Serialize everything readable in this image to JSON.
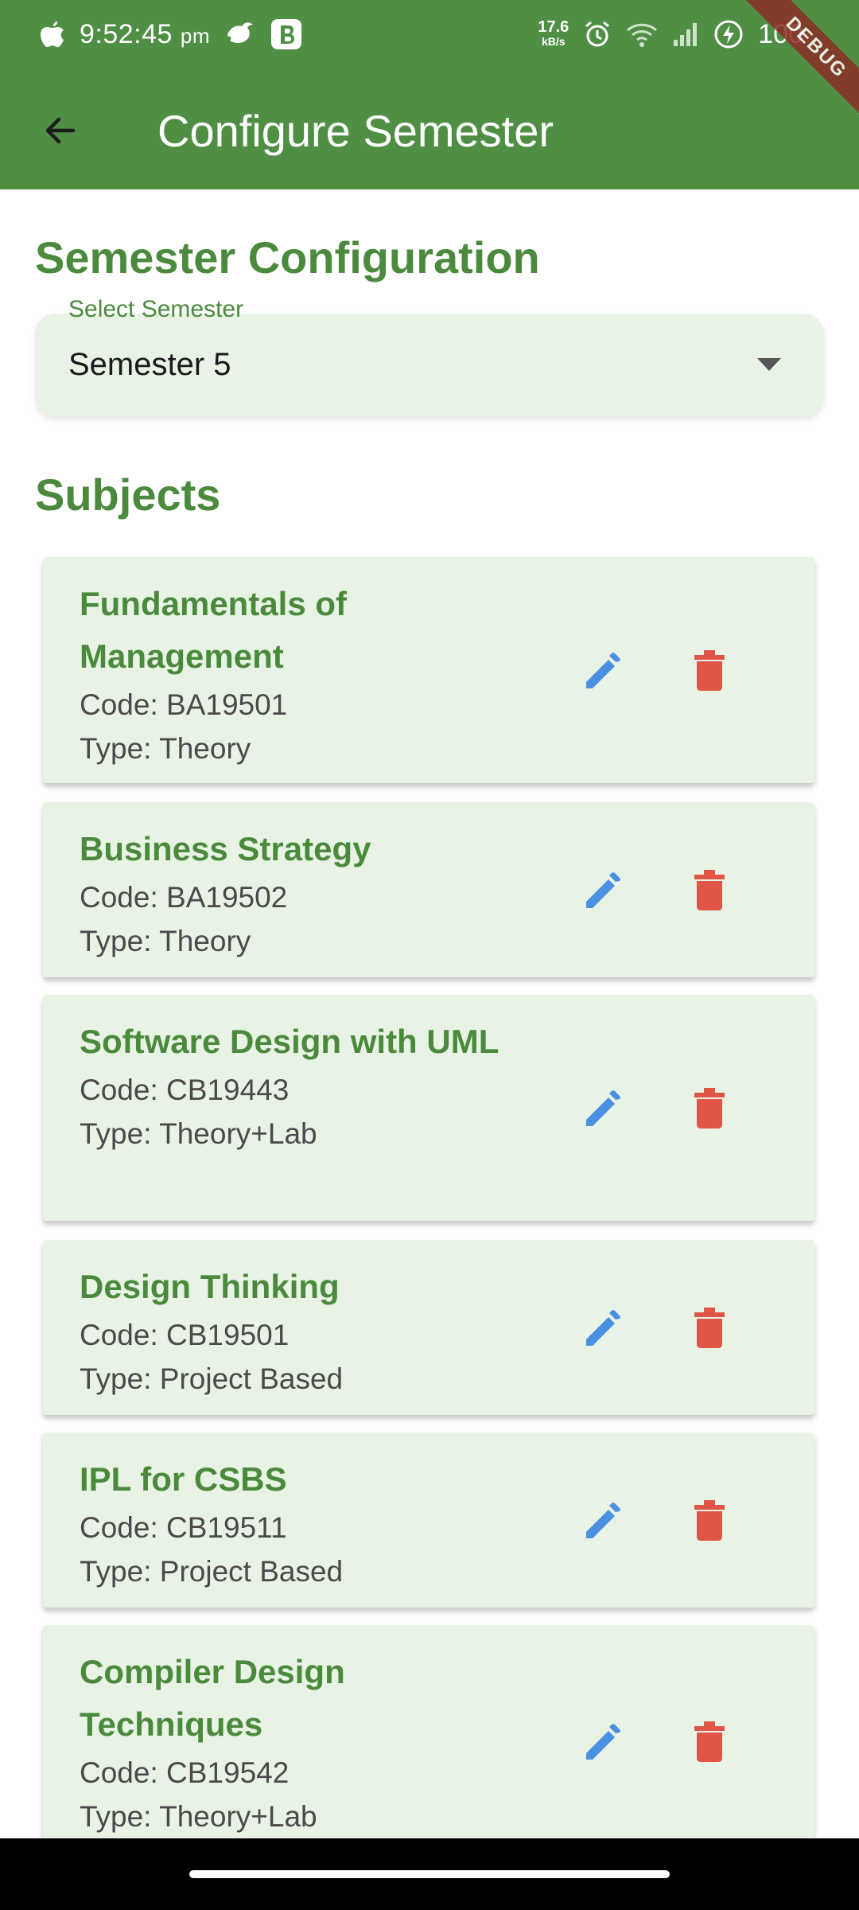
{
  "status_bar": {
    "time": "9:52:45",
    "period": "pm",
    "speed_value": "17.6",
    "speed_unit": "kB/s",
    "battery": "100"
  },
  "debug_label": "DEBUG",
  "app_bar": {
    "title": "Configure Semester"
  },
  "config": {
    "heading": "Semester Configuration",
    "select_label": "Select Semester",
    "select_value": "Semester 5"
  },
  "subjects_heading": "Subjects",
  "subjects": [
    {
      "name": "Fundamentals of Management",
      "code": "Code: BA19501",
      "type": "Type: Theory"
    },
    {
      "name": "Business Strategy",
      "code": "Code: BA19502",
      "type": "Type: Theory"
    },
    {
      "name": "Software Design with UML",
      "code": "Code: CB19443",
      "type": "Type: Theory+Lab"
    },
    {
      "name": "Design Thinking",
      "code": "Code: CB19501",
      "type": "Type: Project Based"
    },
    {
      "name": "IPL for CSBS",
      "code": "Code: CB19511",
      "type": "Type: Project Based"
    },
    {
      "name": "Compiler Design Techniques",
      "code": "Code: CB19542",
      "type": "Type: Theory+Lab"
    }
  ],
  "icons": {
    "back": "arrow-left-icon",
    "edit": "pencil-icon",
    "delete": "trash-icon",
    "dropdown": "caret-down-icon"
  },
  "colors": {
    "primary": "#4f8f44",
    "heading_green": "#4b8a3d",
    "card_bg": "#e8f3e5",
    "edit_blue": "#4a90e2",
    "delete_red": "#e05545"
  }
}
